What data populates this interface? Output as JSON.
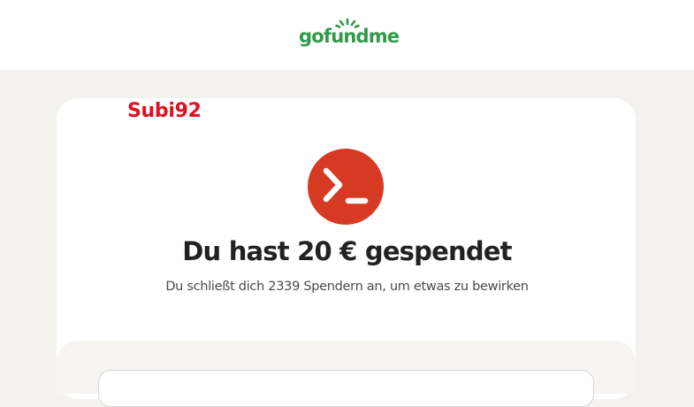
{
  "header": {
    "logo_text": "gofundme",
    "brand_color": "#2f9a47"
  },
  "overlay": {
    "label": "Subi92",
    "color": "#e01020"
  },
  "confirmation": {
    "avatar_icon": "terminal-prompt-icon",
    "avatar_color": "#d63a22",
    "headline": "Du hast 20 € gespendet",
    "subtitle": "Du schließt dich 2339 Spendern an, um etwas zu bewirken"
  }
}
